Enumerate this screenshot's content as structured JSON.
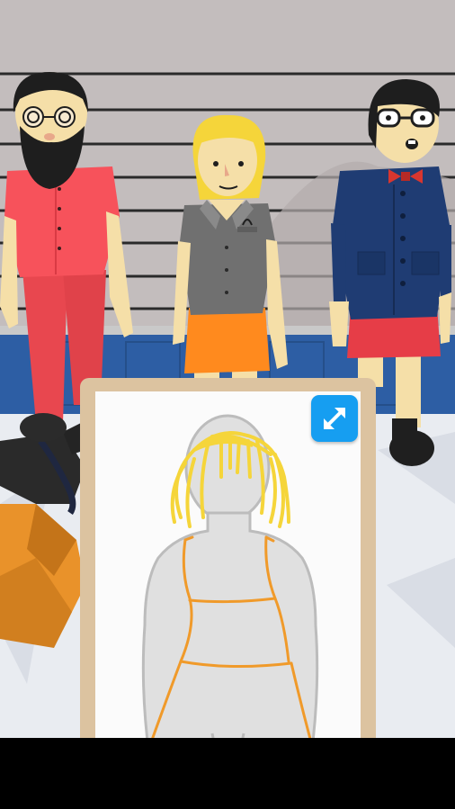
{
  "game": {
    "screen": "suspect-lineup",
    "suspects": [
      {
        "id": "bearded-man",
        "shirt_color": "#f7525b",
        "pants_color": "#e8474f"
      },
      {
        "id": "blonde-woman",
        "shirt_color": "#707070",
        "skirt_color": "#ff8a1e"
      },
      {
        "id": "glasses-woman",
        "coat_color": "#1f3c73",
        "skirt_color": "#e63d47",
        "bowtie_color": "#d8362f"
      }
    ],
    "sketch": {
      "hair_color": "#f5d53a",
      "outfit_color": "#f09a2a",
      "silhouette_color": "#d9d9d9"
    },
    "expand_icon": "expand-arrows-icon",
    "colors": {
      "wall": "#c3bdbd",
      "wainscot": "#2d5ea4",
      "floor": "#e9ecf1",
      "frame": "#dcc3a0",
      "expand_button": "#169ef1"
    }
  }
}
